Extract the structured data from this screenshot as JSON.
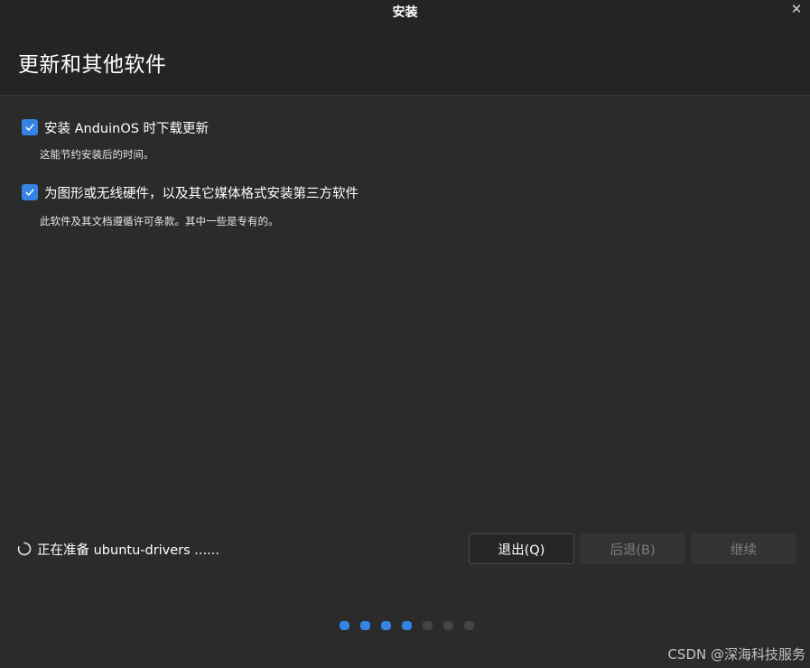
{
  "window": {
    "title": "安装",
    "close_icon": "close-icon"
  },
  "page": {
    "heading": "更新和其他软件"
  },
  "options": [
    {
      "label": "安装 AnduinOS 时下载更新",
      "description": "这能节约安装后的时间。",
      "checked": true
    },
    {
      "label": "为图形或无线硬件，以及其它媒体格式安装第三方软件",
      "description": "此软件及其文档遵循许可条款。其中一些是专有的。",
      "checked": true
    }
  ],
  "status": {
    "icon": "spinner-icon",
    "text": "正在准备 ubuntu-drivers ......"
  },
  "buttons": {
    "quit": "退出(Q)",
    "back": "后退(B)",
    "continue": "继续"
  },
  "progress": {
    "total_steps": 7,
    "completed_steps": 4
  },
  "watermark": "CSDN @深海科技服务",
  "colors": {
    "accent": "#3584e4",
    "background": "#2b2b2b",
    "header": "#242424"
  }
}
